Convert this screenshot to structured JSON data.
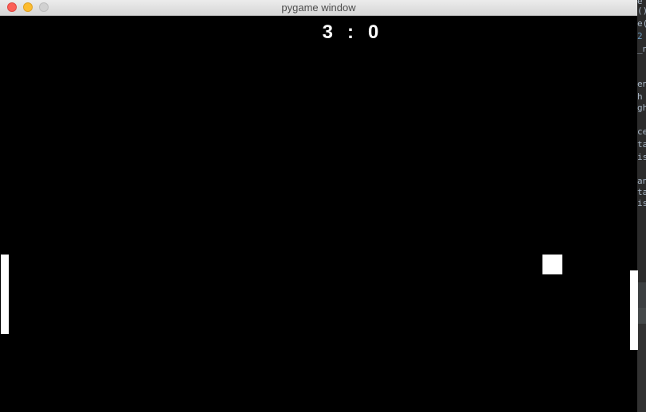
{
  "window": {
    "title": "pygame window"
  },
  "score": {
    "left": "3",
    "separator": ":",
    "right": "0"
  },
  "background_editor": {
    "lines": [
      "e",
      "()",
      "e(",
      " 2",
      "_n",
      "en",
      "h",
      "gh",
      "ce",
      "ta",
      "is",
      "an",
      "ta",
      "is"
    ]
  },
  "colors": {
    "game_background": "#000000",
    "foreground": "#ffffff",
    "close_button": "#fc5f57",
    "minimize_button": "#fdbc2e",
    "zoom_button": "#d1d1d1"
  }
}
